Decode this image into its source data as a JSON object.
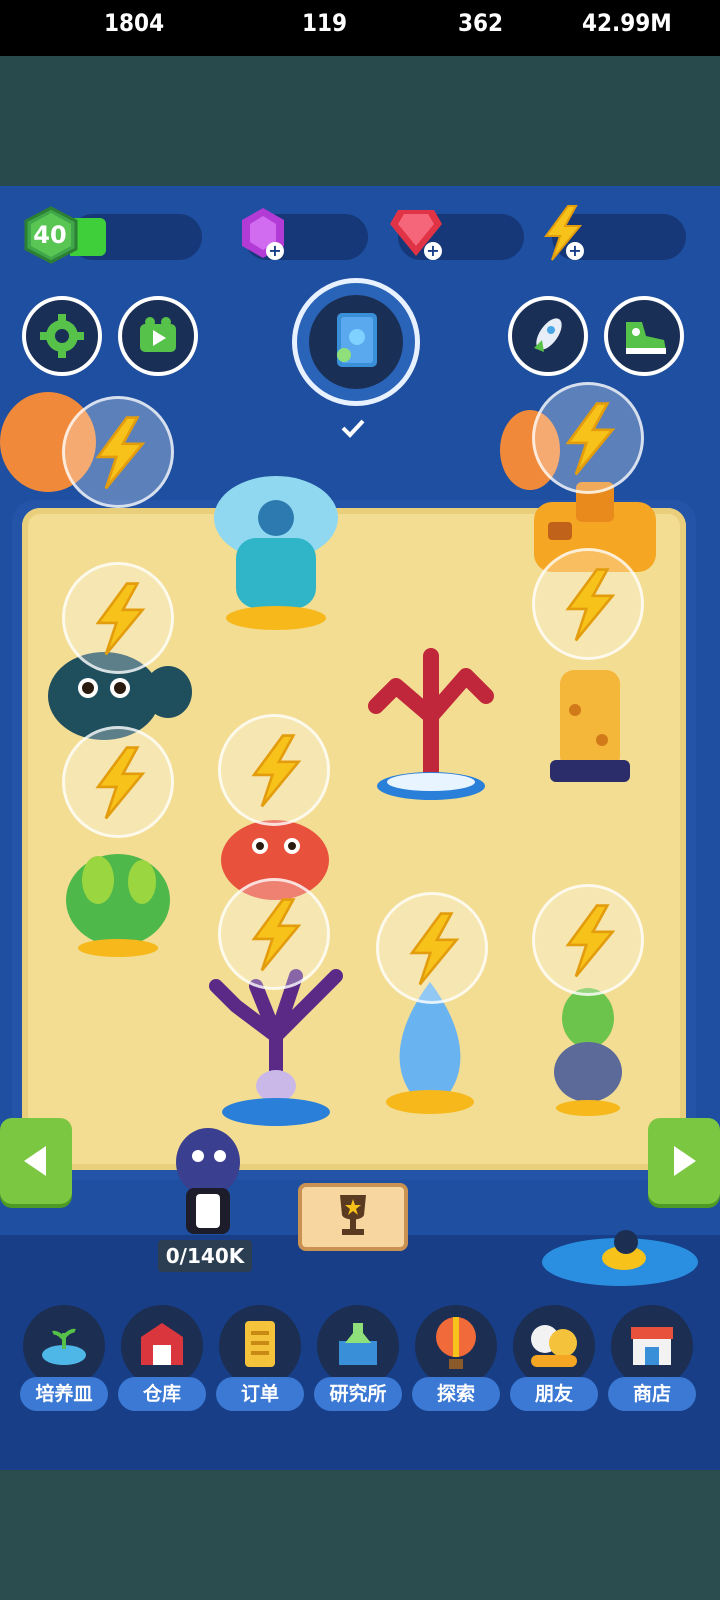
{
  "resources": {
    "level": "40",
    "xp": "1804",
    "purple_gems": "119",
    "red_gems": "362",
    "energy": "42.99M"
  },
  "icons": {
    "settings": "gear-icon",
    "video": "video-play-icon",
    "book": "book-icon",
    "rocket": "rocket-icon",
    "shoe": "sneaker-icon"
  },
  "field": {
    "plants": [
      {
        "name": "blue-flower-creature"
      },
      {
        "name": "red-coral"
      },
      {
        "name": "purple-coral"
      },
      {
        "name": "blue-flame-plant"
      },
      {
        "name": "green-cactus-plant"
      },
      {
        "name": "dark-teal-cactus"
      },
      {
        "name": "yellow-giraffe-plant"
      },
      {
        "name": "orange-castle"
      },
      {
        "name": "red-mushroom-creature"
      },
      {
        "name": "pineapple-plant"
      }
    ]
  },
  "storage_counter": "0/140K",
  "nav": [
    {
      "label": "培养皿",
      "icon": "petri-dish-icon"
    },
    {
      "label": "仓库",
      "icon": "barn-icon"
    },
    {
      "label": "订单",
      "icon": "order-scroll-icon"
    },
    {
      "label": "研究所",
      "icon": "lab-icon"
    },
    {
      "label": "探索",
      "icon": "balloon-icon"
    },
    {
      "label": "朋友",
      "icon": "friends-icon"
    },
    {
      "label": "商店",
      "icon": "shop-icon"
    }
  ],
  "colors": {
    "panel": "#1e4fa0",
    "sand": "#f3dd93",
    "nav_label": "#3b79d4",
    "arrow": "#7cc742"
  }
}
